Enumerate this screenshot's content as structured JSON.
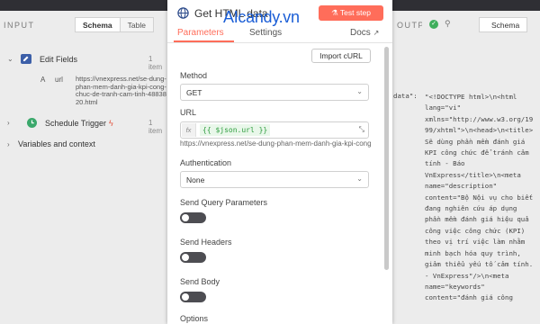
{
  "input_panel": {
    "label": "INPUT",
    "tabs": [
      "Schema",
      "Table"
    ],
    "tree": [
      {
        "label": "Edit Fields",
        "count": "1 item"
      },
      {
        "label": "Schedule Trigger",
        "count": "1 item"
      },
      {
        "label": "Variables and context"
      }
    ],
    "field": {
      "type": "A",
      "name": "url",
      "value": "https://vnexpress.net/se-dung-phan-mem-danh-gia-kpi-cong-chuc-de-tranh-cam-tinh-4883820.html"
    }
  },
  "modal": {
    "title": "Get HTML data",
    "watermark": "AIcandy.vn",
    "test_button": "Test step",
    "tabs": {
      "parameters": "Parameters",
      "settings": "Settings",
      "docs": "Docs"
    },
    "import_button": "Import cURL",
    "method": {
      "label": "Method",
      "value": "GET"
    },
    "url": {
      "label": "URL",
      "fx": "fx",
      "expression": "{{ $json.url }}",
      "resolved": "https://vnexpress.net/se-dung-phan-mem-danh-gia-kpi-cong-chuc-de-tranh-cam-tinh-4883820.html"
    },
    "authentication": {
      "label": "Authentication",
      "value": "None"
    },
    "send_query": {
      "label": "Send Query Parameters",
      "on": false
    },
    "send_headers": {
      "label": "Send Headers",
      "on": false
    },
    "send_body": {
      "label": "Send Body",
      "on": false
    },
    "options_label": "Options",
    "accent_color": "#ff6d5a"
  },
  "output_panel": {
    "label": "OUTPUT",
    "tab": "Schema",
    "key": "data",
    "code": "\"<!DOCTYPE html>\\n<html lang=\"vi\" xmlns=\"http://www.w3.org/1999/xhtml\">\\n<head>\\n<title>Sẽ dùng phần mềm đánh giá KPI công chức để tránh cảm tính - Báo VnExpress</title>\\n<meta name=\"description\" content=\"Bộ Nội vụ cho biết đang nghiên cứu áp dụng phần mềm đánh giá hiệu quả công việc công chức (KPI) theo vị trí việc làm nhằm minh bạch hóa quy trình, giảm thiểu yếu tố cảm tính. - VnExpress\"/>\\n<meta name=\"keywords\" content=\"đánh giá công"
  }
}
